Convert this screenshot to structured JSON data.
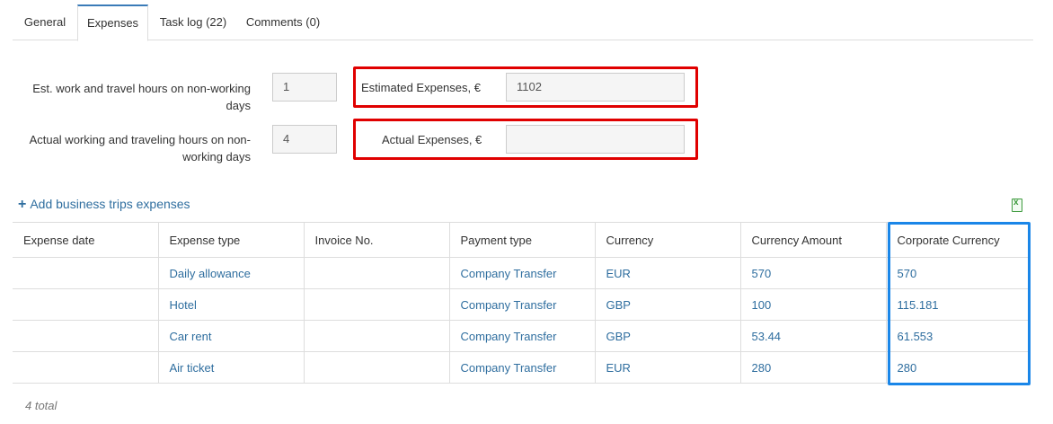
{
  "tabs": [
    {
      "label": "General"
    },
    {
      "label": "Expenses"
    },
    {
      "label": "Task log (22)"
    },
    {
      "label": "Comments (0)"
    }
  ],
  "form": {
    "est_hours_label": "Est. work and travel hours on non-working days",
    "est_hours_value": "1",
    "actual_hours_label": "Actual working and traveling hours on non-working days",
    "actual_hours_value": "4",
    "estimated_expenses_label": "Estimated Expenses, €",
    "estimated_expenses_value": "1102",
    "actual_expenses_label": "Actual Expenses, €",
    "actual_expenses_value": ""
  },
  "add_expenses_label": "Add business trips expenses",
  "export_icon": "excel-export-icon",
  "table": {
    "headers": [
      "Expense date",
      "Expense type",
      "Invoice No.",
      "Payment type",
      "Currency",
      "Currency Amount",
      "Corporate Currency"
    ],
    "rows": [
      [
        "",
        "Daily allowance",
        "",
        "Company Transfer",
        "EUR",
        "570",
        "570"
      ],
      [
        "",
        "Hotel",
        "",
        "Company Transfer",
        "GBP",
        "100",
        "115.181"
      ],
      [
        "",
        "Car rent",
        "",
        "Company Transfer",
        "GBP",
        "53.44",
        "61.553"
      ],
      [
        "",
        "Air ticket",
        "",
        "Company Transfer",
        "EUR",
        "280",
        "280"
      ]
    ]
  },
  "total_label": "4 total",
  "colors": {
    "link": "#2f6e9f",
    "highlight_red": "#e00000",
    "highlight_blue": "#1a86e8",
    "tab_active_accent": "#3a7bb8"
  }
}
